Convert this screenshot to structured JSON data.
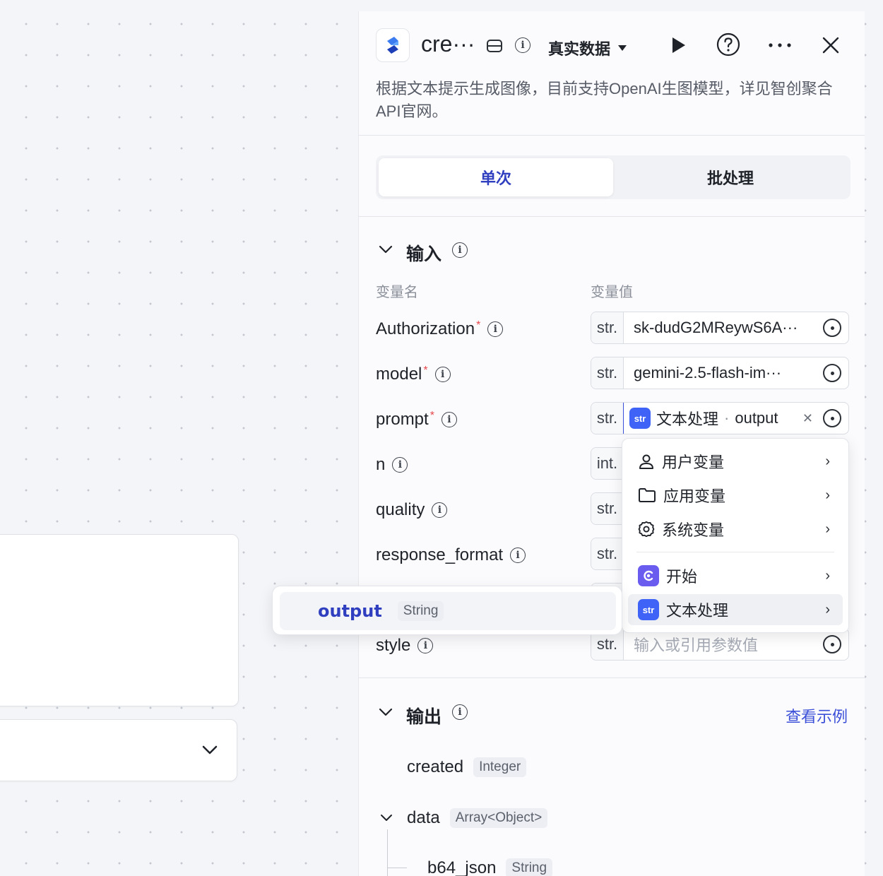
{
  "header": {
    "title": "cre···",
    "data_mode": "真实数据",
    "description": "根据文本提示生成图像，目前支持OpenAI生图模型，详见智创聚合API官网。"
  },
  "tabs": [
    {
      "label": "单次",
      "active": true
    },
    {
      "label": "批处理",
      "active": false
    }
  ],
  "input": {
    "title": "输入",
    "col_name": "变量名",
    "col_value": "变量值",
    "params": [
      {
        "name": "Authorization",
        "required": true,
        "type": "str.",
        "value": "sk-dudG2MReywS6A···"
      },
      {
        "name": "model",
        "required": true,
        "type": "str.",
        "value": "gemini-2.5-flash-im···"
      },
      {
        "name": "prompt",
        "required": true,
        "type": "str.",
        "ref_source": "文本处理",
        "ref_sep": "·",
        "ref_field": "output"
      },
      {
        "name": "n",
        "required": false,
        "type": "int."
      },
      {
        "name": "quality",
        "required": false,
        "type": "str."
      },
      {
        "name": "response_format",
        "required": false,
        "type": "str."
      },
      {
        "name": "style",
        "required": false,
        "type": "str.",
        "placeholder": "输入或引用参数值"
      }
    ]
  },
  "ref_menu": {
    "items": [
      {
        "label": "用户变量",
        "icon": "user-icon"
      },
      {
        "label": "应用变量",
        "icon": "folder-icon"
      },
      {
        "label": "系统变量",
        "icon": "gear-icon"
      },
      {
        "label": "开始",
        "icon": "start-node-icon"
      },
      {
        "label": "文本处理",
        "icon": "text-process-node-icon"
      }
    ],
    "submenu": {
      "name": "output",
      "type": "String"
    }
  },
  "output": {
    "title": "输出",
    "example_link": "查看示例",
    "fields": [
      {
        "name": "created",
        "type": "Integer"
      },
      {
        "name": "data",
        "type": "Array<Object>"
      },
      {
        "name": "b64_json",
        "type": "String"
      }
    ]
  },
  "colors": {
    "accent": "#3b4fd8",
    "badge": "#3e63f6",
    "required": "#e5484d"
  }
}
